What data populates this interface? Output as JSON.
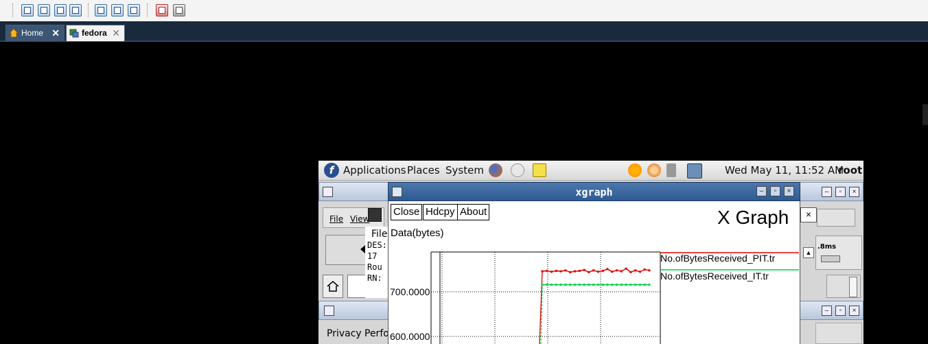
{
  "host": {
    "tabs": [
      {
        "label": "Home"
      },
      {
        "label": "fedora"
      }
    ],
    "close_glyph": "✕"
  },
  "panel": {
    "menus": [
      "Applications",
      "Places",
      "System"
    ],
    "clock": "Wed May 11, 11:52 AM",
    "user": "root",
    "icons": [
      "fedora-logo-icon",
      "firefox-icon",
      "email-icon",
      "notes-icon",
      "update-icon",
      "headphones-icon",
      "volume-icon",
      "network-icon"
    ]
  },
  "back_window": {
    "menu_file": "File",
    "menu_view": "View",
    "left_lines": [
      "File",
      "DES:",
      "17",
      "Rou",
      "RN:"
    ],
    "right_label": ".8ms",
    "second_window_tabs": [
      "Privacy",
      "Perfo"
    ]
  },
  "xgraph": {
    "window_title": "xgraph",
    "buttons": {
      "close": "Close",
      "hdcpy": "Hdcpy",
      "about": "About"
    },
    "title": "X Graph",
    "ylabel": "Data(bytes)",
    "yticks": [
      "700.0000",
      "600.0000"
    ]
  },
  "chart_data": {
    "type": "line",
    "title": "X Graph",
    "xlabel": "",
    "ylabel": "Data(bytes)",
    "y_tick_labels": [
      "700.0000",
      "600.0000"
    ],
    "grid": true,
    "legend_placement": "right",
    "series": [
      {
        "name": "No.ofBytesReceived_PIT.tr",
        "color": "#e00000",
        "values": [
          746,
          747,
          745,
          747,
          746,
          748,
          744,
          746,
          747,
          749,
          744,
          748,
          745,
          747,
          751,
          745,
          748,
          746,
          752,
          744,
          748,
          745,
          750,
          748
        ]
      },
      {
        "name": "No.ofBytesReceived_IT.tr",
        "color": "#00d04a",
        "values": [
          716,
          716,
          716,
          716,
          716,
          716,
          716,
          716,
          716,
          716,
          716,
          716,
          716,
          716,
          716,
          716,
          716,
          716,
          716,
          716,
          716,
          716,
          716,
          716
        ]
      }
    ]
  }
}
